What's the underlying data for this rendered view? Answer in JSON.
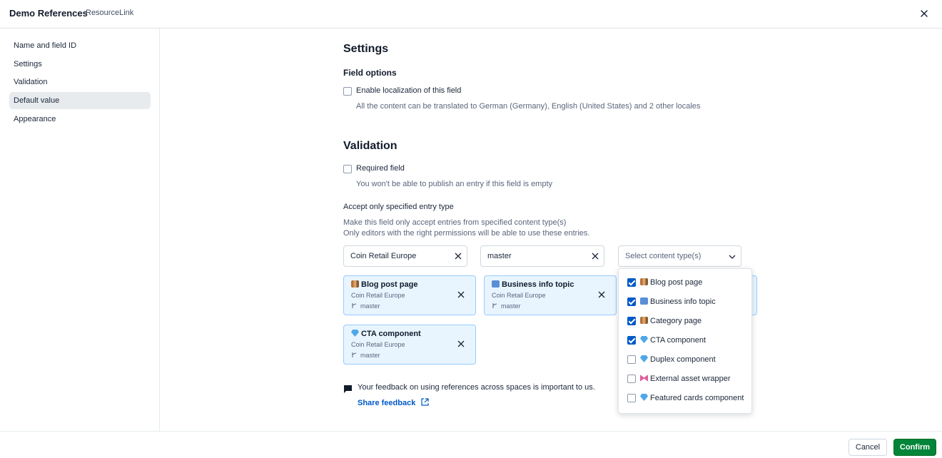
{
  "header": {
    "title": "Demo References",
    "subtitle": "ResourceLink"
  },
  "sidebar": {
    "items": [
      {
        "label": "Name and field ID"
      },
      {
        "label": "Settings"
      },
      {
        "label": "Validation"
      },
      {
        "label": "Default value",
        "active": true
      },
      {
        "label": "Appearance"
      }
    ]
  },
  "settings": {
    "heading": "Settings",
    "field_options": "Field options",
    "localization_label": "Enable localization of this field",
    "localization_help": "All the content can be translated to German (Germany), English (United States) and 2 other locales"
  },
  "validation": {
    "heading": "Validation",
    "required_label": "Required field",
    "required_help": "You won't be able to publish an entry if this field is empty",
    "accept_heading": "Accept only specified entry type",
    "accept_help_1": "Make this field only accept entries from specified content type(s)",
    "accept_help_2": "Only editors with the right permissions will be able to use these entries.",
    "space_value": "Coin Retail Europe",
    "env_value": "master",
    "content_type_placeholder": "Select content type(s)"
  },
  "cards": [
    {
      "title": "Blog post page",
      "space": "Coin Retail Europe",
      "env": "master",
      "icon": "books-emoji"
    },
    {
      "title": "Business info topic",
      "space": "Coin Retail Europe",
      "env": "master",
      "icon": "hash-emoji"
    },
    {
      "title": "CTA component",
      "space": "Coin Retail Europe",
      "env": "master",
      "icon": "gem-emoji"
    }
  ],
  "dropdown": {
    "items": [
      {
        "label": "Blog post page",
        "checked": true,
        "icon": "books-emoji"
      },
      {
        "label": "Business info topic",
        "checked": true,
        "icon": "hash-emoji"
      },
      {
        "label": "Category page",
        "checked": true,
        "icon": "books-emoji"
      },
      {
        "label": "CTA component",
        "checked": true,
        "icon": "gem-emoji"
      },
      {
        "label": "Duplex component",
        "checked": false,
        "icon": "gem-emoji"
      },
      {
        "label": "External asset wrapper",
        "checked": false,
        "icon": "ribbon-emoji"
      },
      {
        "label": "Featured cards component",
        "checked": false,
        "icon": "gem-emoji"
      }
    ]
  },
  "feedback": {
    "text": "Your feedback on using references across spaces is important to us.",
    "link": "Share feedback"
  },
  "footer": {
    "cancel": "Cancel",
    "confirm": "Confirm"
  },
  "colors": {
    "primary": "#008539",
    "accent": "#0059c8",
    "card_bg": "#e8f5ff",
    "active_nav": "#e7ebee"
  }
}
